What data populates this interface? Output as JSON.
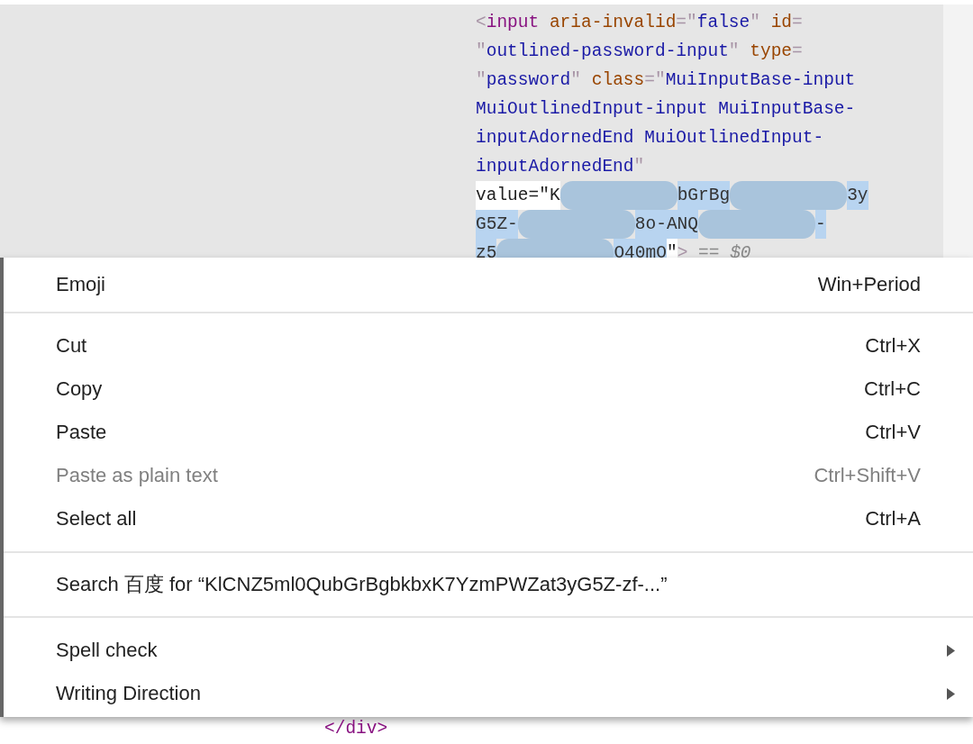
{
  "code_lines": [
    [
      {
        "kind": "punct",
        "text": "<"
      },
      {
        "kind": "tag",
        "text": "input"
      },
      {
        "kind": "attr",
        "text": " aria-invalid"
      },
      {
        "kind": "punct",
        "text": "=\""
      },
      {
        "kind": "val",
        "text": "false"
      },
      {
        "kind": "punct",
        "text": "\" "
      },
      {
        "kind": "attr",
        "text": "id"
      },
      {
        "kind": "punct",
        "text": "="
      }
    ],
    [
      {
        "kind": "punct",
        "text": "\""
      },
      {
        "kind": "val",
        "text": "outlined-password-input"
      },
      {
        "kind": "punct",
        "text": "\" "
      },
      {
        "kind": "attr",
        "text": "type"
      },
      {
        "kind": "punct",
        "text": "="
      }
    ],
    [
      {
        "kind": "punct",
        "text": "\""
      },
      {
        "kind": "val",
        "text": "password"
      },
      {
        "kind": "punct",
        "text": "\" "
      },
      {
        "kind": "attr",
        "text": "class"
      },
      {
        "kind": "punct",
        "text": "=\""
      },
      {
        "kind": "val",
        "text": "MuiInputBase-input"
      }
    ],
    [
      {
        "kind": "val",
        "text": "MuiOutlinedInput-input MuiInputBase-"
      }
    ],
    [
      {
        "kind": "val",
        "text": "inputAdornedEnd MuiOutlinedInput-"
      }
    ],
    [
      {
        "kind": "val",
        "text": "inputAdornedEnd"
      },
      {
        "kind": "punct",
        "text": "\""
      }
    ],
    [
      {
        "kind": "edit",
        "text": "value=\"K"
      },
      {
        "kind": "redacted"
      },
      {
        "kind": "sel",
        "text": "bGrBg"
      },
      {
        "kind": "redacted"
      },
      {
        "kind": "sel",
        "text": "3y"
      }
    ],
    [
      {
        "kind": "sel",
        "text": "G5Z-"
      },
      {
        "kind": "redacted"
      },
      {
        "kind": "sel",
        "text": "8o-ANQ"
      },
      {
        "kind": "redacted"
      },
      {
        "kind": "sel",
        "text": "-"
      }
    ],
    [
      {
        "kind": "sel",
        "text": "z5"
      },
      {
        "kind": "redacted"
      },
      {
        "kind": "sel",
        "text": "O40mO"
      },
      {
        "kind": "edit",
        "text": "\""
      },
      {
        "kind": "punct",
        "text": "> "
      },
      {
        "kind": "dim",
        "text": "== $0"
      }
    ]
  ],
  "menu": [
    [
      {
        "label": "Emoji",
        "shortcut": "Win+Period",
        "disabled": false,
        "submenu": false
      }
    ],
    [
      {
        "label": "Cut",
        "shortcut": "Ctrl+X",
        "disabled": false,
        "submenu": false
      },
      {
        "label": "Copy",
        "shortcut": "Ctrl+C",
        "disabled": false,
        "submenu": false
      },
      {
        "label": "Paste",
        "shortcut": "Ctrl+V",
        "disabled": false,
        "submenu": false
      },
      {
        "label": "Paste as plain text",
        "shortcut": "Ctrl+Shift+V",
        "disabled": true,
        "submenu": false
      },
      {
        "label": "Select all",
        "shortcut": "Ctrl+A",
        "disabled": false,
        "submenu": false
      }
    ],
    [
      {
        "label": "Search 百度 for “KlCNZ5ml0QubGrBgbkbxK7YzmPWZat3yG5Z-zf-...”",
        "disabled": false,
        "submenu": false
      }
    ],
    [
      {
        "label": "Spell check",
        "disabled": false,
        "submenu": true
      },
      {
        "label": "Writing Direction",
        "disabled": false,
        "submenu": true
      }
    ]
  ],
  "bottom_code": "</div>"
}
